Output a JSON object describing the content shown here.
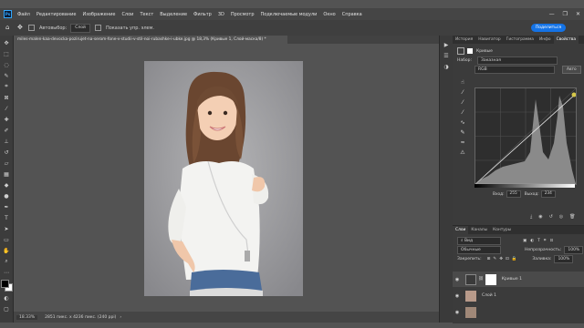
{
  "app": {
    "menu": [
      "Файл",
      "Редактирование",
      "Изображение",
      "Слои",
      "Текст",
      "Выделение",
      "Фильтр",
      "3D",
      "Просмотр",
      "Подключаемые модули",
      "Окно",
      "Справка"
    ],
    "logo": "Ps",
    "window_buttons": [
      "—",
      "❐",
      "✕"
    ]
  },
  "options_bar": {
    "autoselect_label": "Автовыбор:",
    "autoselect_value": "Слой",
    "transform_label": "Показать упр. элем.",
    "share_label": "Поделиться"
  },
  "document": {
    "tab_title": "miles-malen-kaa-devocka-pozirujet-na-serom-fone-v-studii-v-stil-noi-rubashke-i-ubke.jpg @ 18,3% (Кривые 1, Слой-маска/8) *",
    "zoom": "18.33%",
    "dimensions": "2851 пикс. x 4236 пикс. (240 ppi)"
  },
  "panel_tabs": [
    "История",
    "Навигатор",
    "Гистограмма",
    "Инфо",
    "Свойства"
  ],
  "properties": {
    "title": "Кривые",
    "preset_label": "Набор:",
    "preset_value": "Заказная",
    "channel_value": "RGB",
    "auto_label": "Авто",
    "input_label": "Вход:",
    "input_value": "255",
    "output_label": "Выход:",
    "output_value": "234"
  },
  "layers_panel": {
    "tabs": [
      "Слои",
      "Каналы",
      "Контуры"
    ],
    "filter_label": "Вид",
    "blend_mode": "Обычные",
    "opacity_label": "Непрозрачность:",
    "opacity_value": "100%",
    "lock_label": "Закрепить:",
    "fill_label": "Заливка:",
    "fill_value": "100%",
    "layers": [
      {
        "name": "Кривые 1"
      },
      {
        "name": "Слой 1"
      },
      {
        "name": ""
      }
    ]
  }
}
